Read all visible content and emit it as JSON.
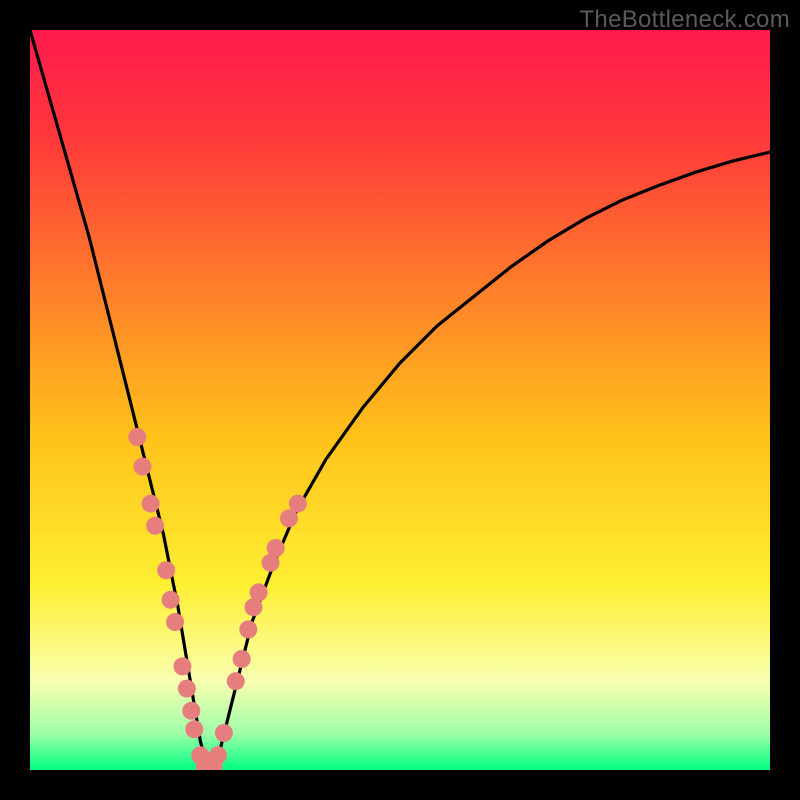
{
  "watermark": "TheBottleneck.com",
  "chart_data": {
    "type": "line",
    "title": "",
    "xlabel": "",
    "ylabel": "",
    "xlim": [
      0,
      100
    ],
    "ylim": [
      0,
      100
    ],
    "grid": false,
    "legend": false,
    "series": [
      {
        "name": "bottleneck-curve",
        "x": [
          0,
          2,
          4,
          6,
          8,
          10,
          12,
          14,
          16,
          18,
          20,
          21,
          22,
          23,
          24,
          25,
          26,
          28,
          30,
          33,
          36,
          40,
          45,
          50,
          55,
          60,
          65,
          70,
          75,
          80,
          85,
          90,
          95,
          100
        ],
        "y": [
          100,
          93,
          86,
          79,
          72,
          64,
          56,
          48,
          40,
          32,
          22,
          16,
          10,
          4,
          0,
          0,
          4,
          12,
          20,
          28,
          35,
          42,
          49,
          55,
          60,
          64,
          68,
          71.5,
          74.5,
          77,
          79,
          80.8,
          82.3,
          83.5
        ]
      }
    ],
    "background_gradient": {
      "type": "vertical",
      "stops": [
        {
          "offset": 0.0,
          "color": "#ff1a4d"
        },
        {
          "offset": 0.15,
          "color": "#ff3a3a"
        },
        {
          "offset": 0.35,
          "color": "#ff7f2a"
        },
        {
          "offset": 0.55,
          "color": "#ffc21a"
        },
        {
          "offset": 0.75,
          "color": "#ffef33"
        },
        {
          "offset": 0.88,
          "color": "#f8ffb0"
        },
        {
          "offset": 0.95,
          "color": "#a0ffa8"
        },
        {
          "offset": 1.0,
          "color": "#00ff80"
        }
      ]
    },
    "markers": {
      "name": "sample-dots",
      "color": "#e77e7e",
      "points": [
        {
          "x": 14.5,
          "y": 45
        },
        {
          "x": 15.2,
          "y": 41
        },
        {
          "x": 16.3,
          "y": 36
        },
        {
          "x": 16.9,
          "y": 33
        },
        {
          "x": 18.4,
          "y": 27
        },
        {
          "x": 19.0,
          "y": 23
        },
        {
          "x": 19.6,
          "y": 20
        },
        {
          "x": 20.6,
          "y": 14
        },
        {
          "x": 21.2,
          "y": 11
        },
        {
          "x": 21.8,
          "y": 8
        },
        {
          "x": 22.2,
          "y": 5.5
        },
        {
          "x": 23.0,
          "y": 2
        },
        {
          "x": 23.6,
          "y": 0.5
        },
        {
          "x": 24.2,
          "y": 0.5
        },
        {
          "x": 24.8,
          "y": 0.5
        },
        {
          "x": 25.4,
          "y": 2
        },
        {
          "x": 26.2,
          "y": 5
        },
        {
          "x": 27.8,
          "y": 12
        },
        {
          "x": 28.6,
          "y": 15
        },
        {
          "x": 29.5,
          "y": 19
        },
        {
          "x": 30.2,
          "y": 22
        },
        {
          "x": 30.9,
          "y": 24
        },
        {
          "x": 32.5,
          "y": 28
        },
        {
          "x": 33.2,
          "y": 30
        },
        {
          "x": 35.0,
          "y": 34
        },
        {
          "x": 36.2,
          "y": 36
        }
      ]
    }
  }
}
